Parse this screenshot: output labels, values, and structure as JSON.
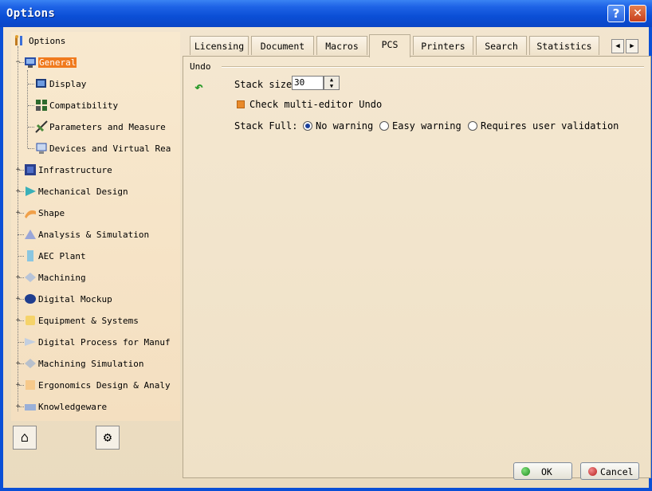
{
  "window": {
    "title": "Options"
  },
  "tree": {
    "items": [
      {
        "label": "Options",
        "icon": "options-root-icon"
      },
      {
        "label": "General",
        "icon": "general-icon",
        "selected": true
      },
      {
        "label": "Display",
        "icon": "display-icon"
      },
      {
        "label": "Compatibility",
        "icon": "compatibility-icon"
      },
      {
        "label": "Parameters and Measure",
        "icon": "parameters-icon"
      },
      {
        "label": "Devices and Virtual Rea",
        "icon": "devices-icon"
      },
      {
        "label": "Infrastructure",
        "icon": "infrastructure-icon"
      },
      {
        "label": "Mechanical Design",
        "icon": "mechanical-design-icon"
      },
      {
        "label": "Shape",
        "icon": "shape-icon"
      },
      {
        "label": "Analysis & Simulation",
        "icon": "analysis-icon"
      },
      {
        "label": "AEC Plant",
        "icon": "aec-plant-icon"
      },
      {
        "label": "Machining",
        "icon": "machining-icon"
      },
      {
        "label": "Digital Mockup",
        "icon": "digital-mockup-icon"
      },
      {
        "label": "Equipment & Systems",
        "icon": "equipment-icon"
      },
      {
        "label": "Digital Process for Manuf",
        "icon": "digital-process-icon"
      },
      {
        "label": "Machining Simulation",
        "icon": "machining-simulation-icon"
      },
      {
        "label": "Ergonomics Design & Analy",
        "icon": "ergonomics-icon"
      },
      {
        "label": "Knowledgeware",
        "icon": "knowledgeware-icon"
      }
    ]
  },
  "tabs": [
    "Licensing",
    "Document",
    "Macros",
    "PCS",
    "Printers",
    "Search",
    "Statistics"
  ],
  "active_tab": "PCS",
  "pcs": {
    "section": "Undo",
    "stack_size_label": "Stack size",
    "stack_size_value": "30",
    "multi_editor_label": "Check multi-editor Undo",
    "stack_full_label": "Stack Full:",
    "options": [
      "No warning",
      "Easy warning",
      "Requires user validation"
    ],
    "selected_option": "No warning"
  },
  "buttons": {
    "ok": "OK",
    "cancel": "Cancel"
  },
  "colors": {
    "titlebar": "#0a4fd6",
    "selection": "#f07a1d",
    "panel": "#f2e5cf"
  }
}
